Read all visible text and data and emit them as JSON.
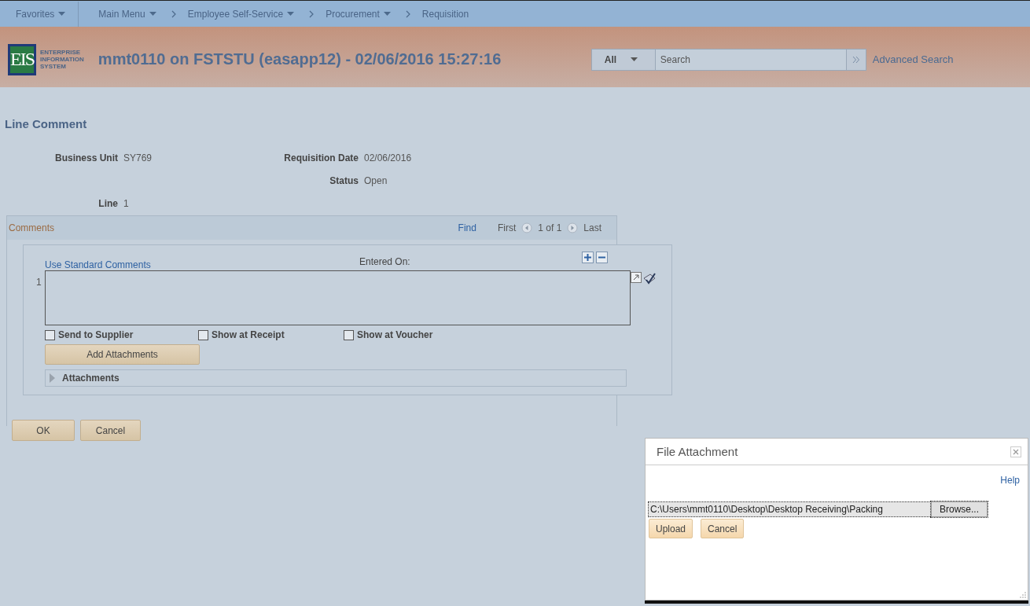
{
  "nav": {
    "items": [
      {
        "label": "Favorites",
        "kind": "menu",
        "dropdown": true
      },
      {
        "label": "Main Menu",
        "kind": "menu",
        "dropdown": true
      },
      {
        "label": "Employee Self-Service",
        "kind": "crumb",
        "dropdown": true
      },
      {
        "label": "Procurement",
        "kind": "crumb",
        "dropdown": true
      },
      {
        "label": "Requisition",
        "kind": "crumb",
        "dropdown": false
      }
    ]
  },
  "header": {
    "logo": {
      "mark": "EIS",
      "lines": [
        "ENTERPRISE",
        "INFORMATION",
        "SYSTEM"
      ]
    },
    "title": "mmt0110 on FSTSTU (easapp12) - 02/06/2016 15:27:16",
    "search": {
      "scope": "All",
      "placeholder": "Search"
    },
    "advanced_link": "Advanced Search"
  },
  "page": {
    "title": "Line Comment",
    "field_rows": [
      {
        "left": {
          "label": "Business Unit",
          "value": "SY769"
        },
        "right": {
          "label": "Requisition Date",
          "value": "02/06/2016"
        }
      },
      {
        "right": {
          "label": "Status",
          "value": "Open"
        }
      },
      {
        "left": {
          "label": "Line",
          "value": "1"
        }
      }
    ]
  },
  "comments": {
    "title": "Comments",
    "find": "Find",
    "first": "First",
    "counter": "1 of 1",
    "last": "Last",
    "standard_link": "Use Standard Comments",
    "entered_on": "Entered On:",
    "row_number": "1",
    "checkboxes": [
      {
        "label": "Send to Supplier",
        "checked": false
      },
      {
        "label": "Show at Receipt",
        "checked": false
      },
      {
        "label": "Show at Voucher",
        "checked": false
      }
    ],
    "add_button": "Add Attachments",
    "attachments": {
      "label": "Attachments",
      "expanded": false
    }
  },
  "buttons": [
    "OK",
    "Cancel"
  ],
  "dialog": {
    "title": "File Attachment",
    "help": "Help",
    "file_path": "C:\\Users\\mmt0110\\Desktop\\Desktop Receiving\\Packing",
    "browse": "Browse...",
    "buttons": [
      "Upload",
      "Cancel"
    ]
  }
}
